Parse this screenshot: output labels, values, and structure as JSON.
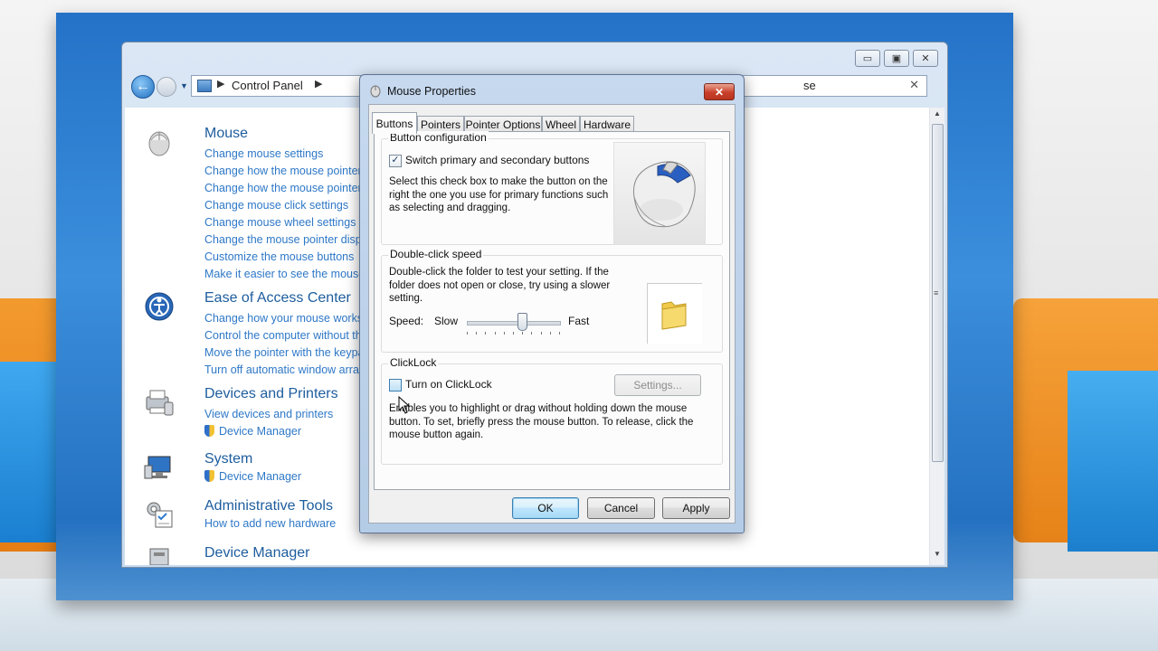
{
  "control_panel": {
    "address": {
      "crumb": "Control Panel",
      "search_text": "se"
    },
    "caption_buttons": {
      "minimize": "▭",
      "maximize": "▣",
      "close": "✕"
    },
    "categories": [
      {
        "title": "Mouse",
        "icon": "mouse-icon",
        "links": [
          "Change mouse settings",
          "Change how the mouse pointer loo",
          "Change how the mouse pointer loo",
          "Change mouse click settings",
          "Change mouse wheel settings",
          "Change the mouse pointer display c",
          "Customize the mouse buttons",
          "Make it easier to see the mouse poi"
        ]
      },
      {
        "title": "Ease of Access Center",
        "icon": "ease-of-access-icon",
        "links": [
          "Change how your mouse works",
          "Control the computer without the m",
          "Move the pointer with the keypad u",
          "Turn off automatic window arrange"
        ]
      },
      {
        "title": "Devices and Printers",
        "icon": "devices-printers-icon",
        "links": [
          "View devices and printers",
          "Device Manager"
        ]
      },
      {
        "title": "System",
        "icon": "system-icon",
        "links": [
          "Device Manager"
        ]
      },
      {
        "title": "Administrative Tools",
        "icon": "admin-tools-icon",
        "links": [
          "How to add new hardware"
        ]
      },
      {
        "title": "Device Manager",
        "icon": "device-manager-icon",
        "links": []
      }
    ]
  },
  "dialog": {
    "title": "Mouse Properties",
    "close_label": "✕",
    "tabs": [
      "Buttons",
      "Pointers",
      "Pointer Options",
      "Wheel",
      "Hardware"
    ],
    "active_tab": "Buttons",
    "button_config": {
      "group_label": "Button configuration",
      "checkbox_label": "Switch primary and secondary buttons",
      "checked": true,
      "check_mark": "✓",
      "description_lines": [
        "Select this check box to make the button on the",
        "right the one you use for primary functions such",
        "as selecting and dragging."
      ]
    },
    "double_click": {
      "group_label": "Double-click speed",
      "description_lines": [
        "Double-click the folder to test your setting.  If the",
        "folder does not open or close, try using a slower",
        "setting."
      ],
      "speed_label": "Speed:",
      "slow_label": "Slow",
      "fast_label": "Fast",
      "speed_fraction": 0.6
    },
    "clicklock": {
      "group_label": "ClickLock",
      "checkbox_label": "Turn on ClickLock",
      "checked": false,
      "settings_button": "Settings...",
      "description_lines": [
        "Enables you to highlight or drag without holding down the mouse",
        "button. To set, briefly press the mouse button. To release, click the",
        "mouse button again."
      ]
    },
    "buttons": {
      "ok": "OK",
      "cancel": "Cancel",
      "apply": "Apply"
    }
  },
  "colors": {
    "link": "#2e78c7",
    "category_title": "#1d5d9e",
    "desktop_blue": "#2472c8"
  }
}
